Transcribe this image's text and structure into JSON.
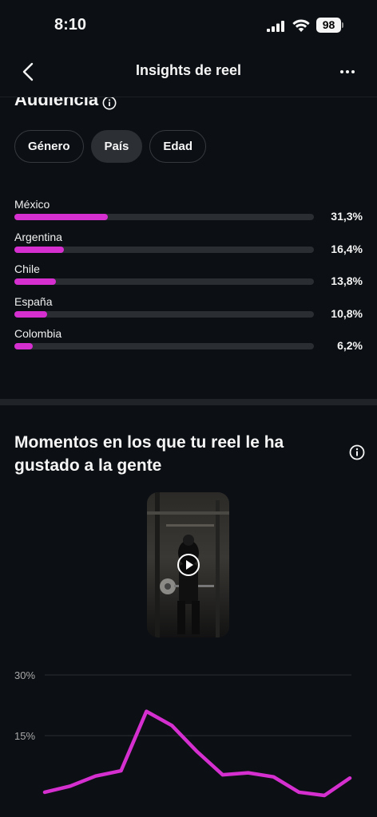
{
  "status_bar": {
    "time": "8:10",
    "battery": "98"
  },
  "header": {
    "title": "Insights de reel"
  },
  "audience": {
    "title": "Audiencia",
    "tabs": [
      {
        "label": "Género",
        "active": false
      },
      {
        "label": "País",
        "active": true
      },
      {
        "label": "Edad",
        "active": false
      }
    ],
    "countries": [
      {
        "name": "México",
        "pct_label": "31,3%",
        "value": 31.3
      },
      {
        "name": "Argentina",
        "pct_label": "16,4%",
        "value": 16.4
      },
      {
        "name": "Chile",
        "pct_label": "13,8%",
        "value": 13.8
      },
      {
        "name": "España",
        "pct_label": "10,8%",
        "value": 10.8
      },
      {
        "name": "Colombia",
        "pct_label": "6,2%",
        "value": 6.2
      }
    ]
  },
  "moments": {
    "title": "Momentos en los que tu reel le ha gustado a la gente"
  },
  "colors": {
    "accent": "#d52fd0",
    "background": "#0c1014"
  },
  "chart_data": {
    "type": "line",
    "ytick_labels": [
      "30%",
      "15%"
    ],
    "yticks": [
      30,
      15
    ],
    "ylim": [
      0,
      33
    ],
    "x": [
      0,
      1,
      2,
      3,
      4,
      5,
      6,
      7,
      8,
      9,
      10,
      11,
      12
    ],
    "values": [
      1,
      2.5,
      5,
      6.3,
      21,
      17.5,
      11,
      5.3,
      5.8,
      4.8,
      1,
      0.2,
      4.5
    ],
    "xlabel": "",
    "ylabel": "",
    "grid": true
  }
}
